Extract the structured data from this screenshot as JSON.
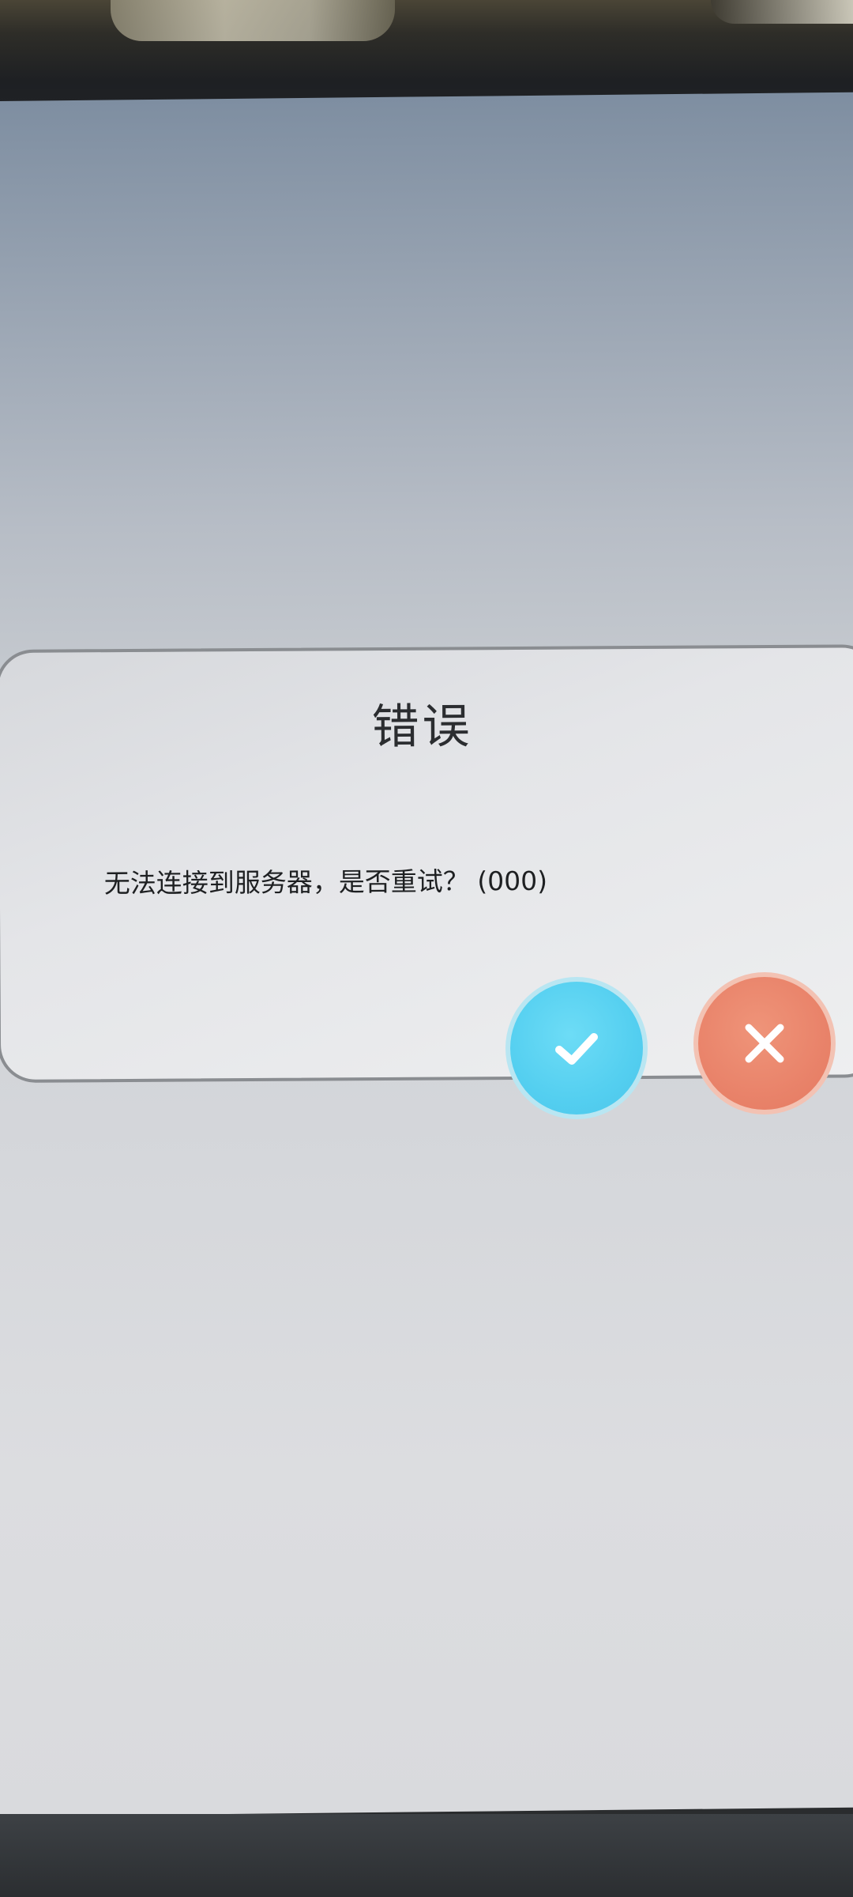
{
  "dialog": {
    "title": "错误",
    "message": "无法连接到服务器，是否重试？ (000)"
  },
  "buttons": {
    "confirm_icon": "check-icon",
    "cancel_icon": "close-icon"
  },
  "colors": {
    "confirm": "#56d0f0",
    "cancel": "#e9836a"
  }
}
